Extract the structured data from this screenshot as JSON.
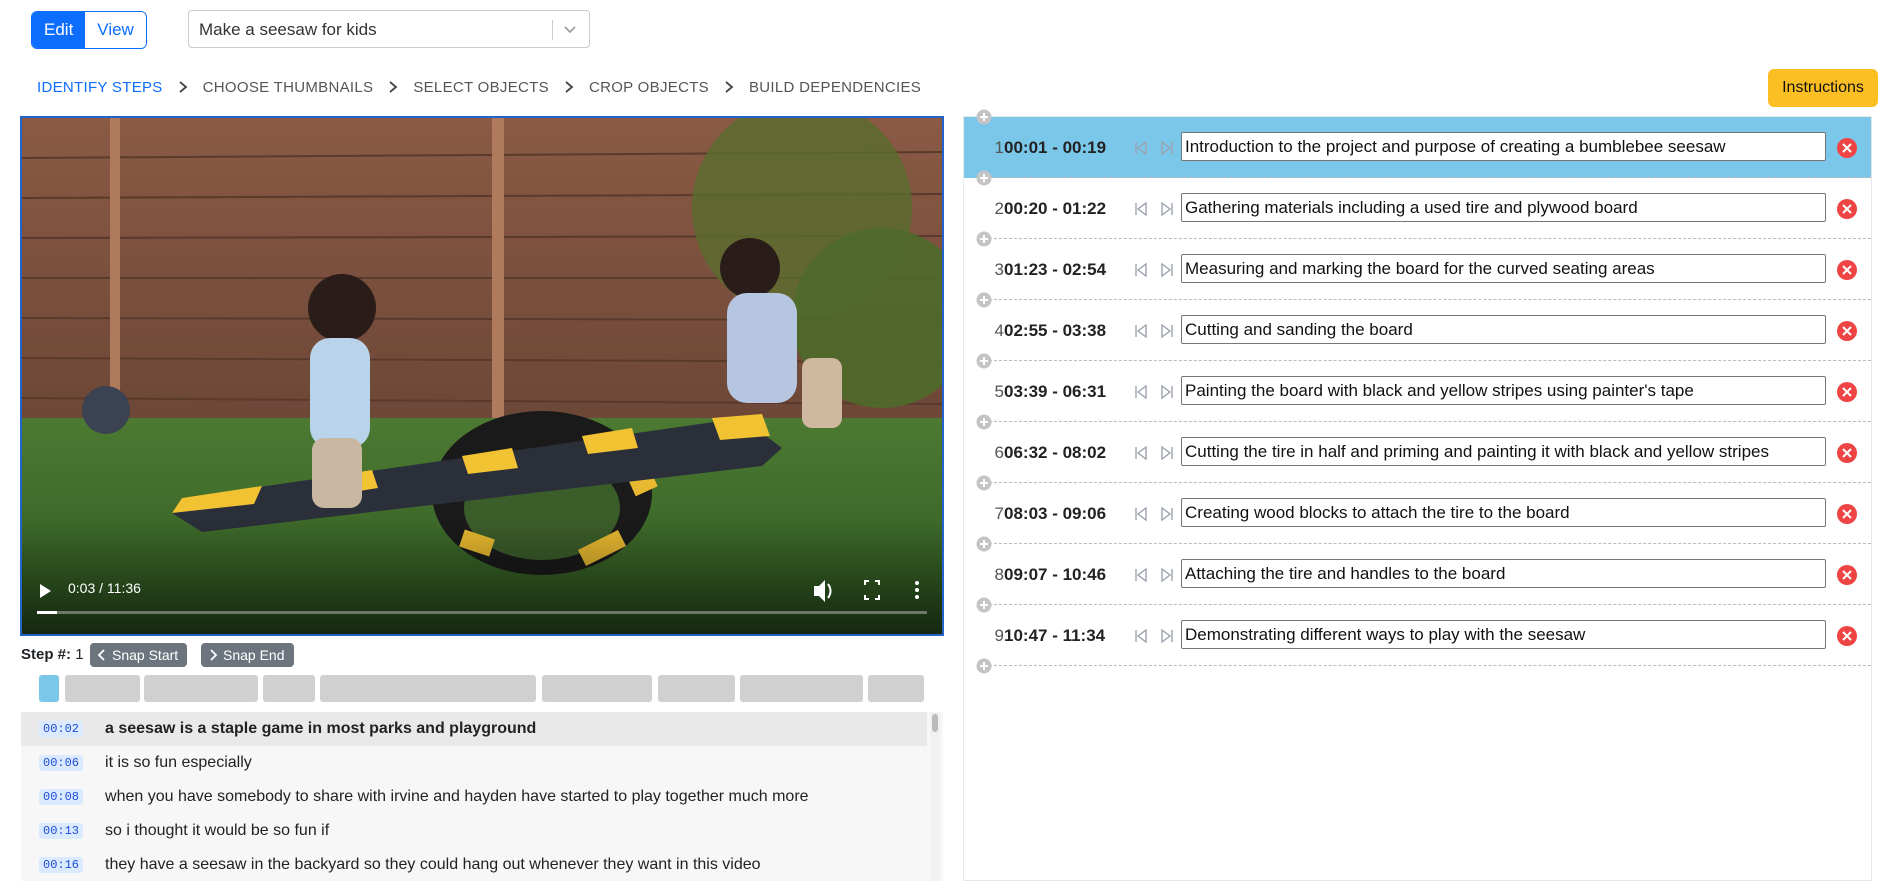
{
  "mode": {
    "edit": "Edit",
    "view": "View"
  },
  "task_select": {
    "value": "Make a seesaw for kids"
  },
  "nav": {
    "steps": [
      "IDENTIFY STEPS",
      "CHOOSE THUMBNAILS",
      "SELECT OBJECTS",
      "CROP OBJECTS",
      "BUILD DEPENDENCIES"
    ],
    "active": 0
  },
  "instructions_label": "Instructions",
  "video": {
    "time": "0:03 / 11:36",
    "progress": 0.0043
  },
  "step_info": {
    "label": "Step #:",
    "value": "1",
    "snap_start": "Snap Start",
    "snap_end": "Snap End"
  },
  "transcript": [
    {
      "time": "00:02",
      "text": "a seesaw is a staple game in most parks and playground",
      "highlight": true
    },
    {
      "time": "00:06",
      "text": "it is so fun especially"
    },
    {
      "time": "00:08",
      "text": "when you have somebody to share with irvine and hayden have started to play together much more"
    },
    {
      "time": "00:13",
      "text": "so i thought it would be so fun if"
    },
    {
      "time": "00:16",
      "text": "they have a seesaw in the backyard so they could hang out whenever they want in this video"
    }
  ],
  "steps": [
    {
      "n": "1",
      "range": "00:01 - 00:19",
      "desc": "Introduction to the project and purpose of creating a bumblebee seesaw"
    },
    {
      "n": "2",
      "range": "00:20 - 01:22",
      "desc": "Gathering materials including a used tire and plywood board"
    },
    {
      "n": "3",
      "range": "01:23 - 02:54",
      "desc": "Measuring and marking the board for the curved seating areas"
    },
    {
      "n": "4",
      "range": "02:55 - 03:38",
      "desc": "Cutting and sanding the board"
    },
    {
      "n": "5",
      "range": "03:39 - 06:31",
      "desc": "Painting the board with black and yellow stripes using painter's tape"
    },
    {
      "n": "6",
      "range": "06:32 - 08:02",
      "desc": "Cutting the tire in half and priming and painting it with black and yellow stripes"
    },
    {
      "n": "7",
      "range": "08:03 - 09:06",
      "desc": "Creating wood blocks to attach the tire to the board"
    },
    {
      "n": "8",
      "range": "09:07 - 10:46",
      "desc": "Attaching the tire and handles to the board"
    },
    {
      "n": "9",
      "range": "10:47 - 11:34",
      "desc": "Demonstrating different ways to play with the seesaw"
    }
  ],
  "colors": {
    "accent": "#0d6efd",
    "selected_row": "#7ac7ea",
    "instructions": "#fbbf24",
    "remove": "#ef4444"
  }
}
